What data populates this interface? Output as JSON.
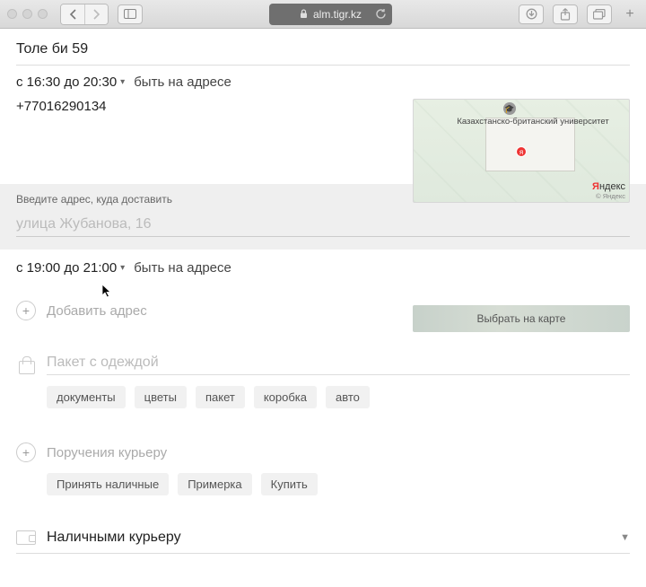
{
  "browser": {
    "url": "alm.tigr.kz"
  },
  "pickup": {
    "address": "Толе  би 59",
    "time_range": "с 16:30 до 20:30",
    "time_note": "быть на адресе",
    "phone": "+77016290134"
  },
  "map1": {
    "uni_label": "Казахстанско-британский университет",
    "pin_label": "я",
    "provider": "Яндекс",
    "provider_sub": "© Яндекс"
  },
  "dropoff": {
    "hint": "Введите адрес, куда доставить",
    "placeholder": "улица Жубанова, 16",
    "time_range": "с 19:00 до 21:00",
    "time_note": "быть на адресе",
    "map_button": "Выбрать на карте"
  },
  "add_address": {
    "label": "Добавить адрес"
  },
  "package": {
    "placeholder": "Пакет с одеждой",
    "tags": [
      "документы",
      "цветы",
      "пакет",
      "коробка",
      "авто"
    ]
  },
  "tasks": {
    "label": "Поручения курьеру",
    "tags": [
      "Принять наличные",
      "Примерка",
      "Купить"
    ]
  },
  "payment": {
    "label": "Наличными курьеру"
  }
}
